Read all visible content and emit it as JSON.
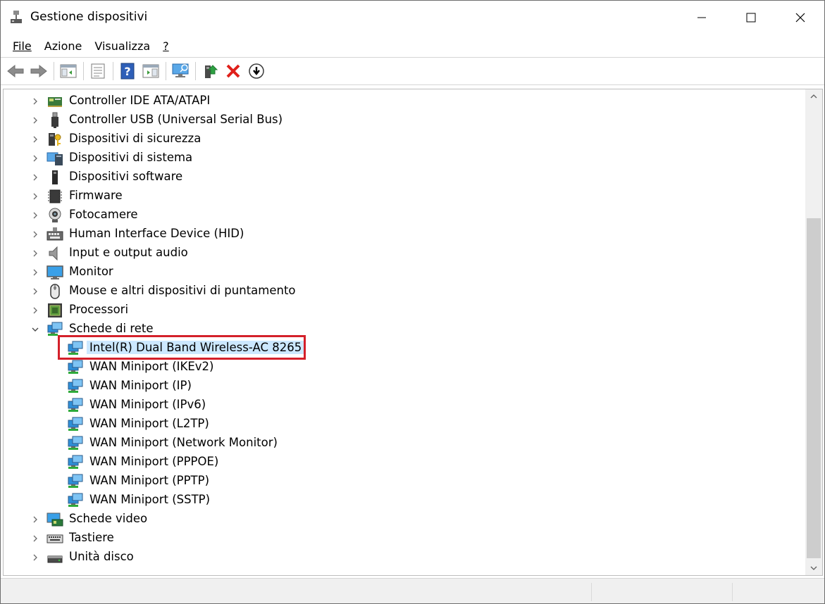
{
  "window": {
    "title": "Gestione dispositivi",
    "controls": {
      "minimize": "minimize-icon",
      "maximize": "maximize-icon",
      "close": "close-icon"
    }
  },
  "menu": [
    {
      "label": "File"
    },
    {
      "label": "Azione"
    },
    {
      "label": "Visualizza"
    },
    {
      "label": "?"
    }
  ],
  "toolbar": {
    "icons": [
      "back-arrow-icon",
      "forward-arrow-icon",
      "show-hide-console-tree-icon",
      "properties-icon",
      "help-icon",
      "action-pane-icon",
      "scan-hardware-icon",
      "update-driver-icon",
      "uninstall-device-icon",
      "disable-device-icon"
    ]
  },
  "tree": {
    "items": [
      {
        "label": "Controller IDE ATA/ATAPI",
        "icon": "ide-controller-icon",
        "expanded": false,
        "level": 0
      },
      {
        "label": "Controller USB (Universal Serial Bus)",
        "icon": "usb-icon",
        "expanded": false,
        "level": 0
      },
      {
        "label": "Dispositivi di sicurezza",
        "icon": "security-key-icon",
        "expanded": false,
        "level": 0
      },
      {
        "label": "Dispositivi di sistema",
        "icon": "system-device-icon",
        "expanded": false,
        "level": 0
      },
      {
        "label": "Dispositivi software",
        "icon": "software-device-icon",
        "expanded": false,
        "level": 0
      },
      {
        "label": "Firmware",
        "icon": "firmware-chip-icon",
        "expanded": false,
        "level": 0
      },
      {
        "label": "Fotocamere",
        "icon": "camera-icon",
        "expanded": false,
        "level": 0
      },
      {
        "label": "Human Interface Device (HID)",
        "icon": "hid-keyboard-icon",
        "expanded": false,
        "level": 0
      },
      {
        "label": "Input e output audio",
        "icon": "speaker-icon",
        "expanded": false,
        "level": 0
      },
      {
        "label": "Monitor",
        "icon": "monitor-icon",
        "expanded": false,
        "level": 0
      },
      {
        "label": "Mouse e altri dispositivi di puntamento",
        "icon": "mouse-icon",
        "expanded": false,
        "level": 0
      },
      {
        "label": "Processori",
        "icon": "processor-icon",
        "expanded": false,
        "level": 0
      },
      {
        "label": "Schede di rete",
        "icon": "network-adapter-icon",
        "expanded": true,
        "level": 0
      },
      {
        "label": "Intel(R) Dual Band Wireless-AC 8265",
        "icon": "network-adapter-icon",
        "level": 1,
        "selected": true
      },
      {
        "label": "WAN Miniport (IKEv2)",
        "icon": "network-adapter-icon",
        "level": 1
      },
      {
        "label": "WAN Miniport (IP)",
        "icon": "network-adapter-icon",
        "level": 1
      },
      {
        "label": "WAN Miniport (IPv6)",
        "icon": "network-adapter-icon",
        "level": 1
      },
      {
        "label": "WAN Miniport (L2TP)",
        "icon": "network-adapter-icon",
        "level": 1
      },
      {
        "label": "WAN Miniport (Network Monitor)",
        "icon": "network-adapter-icon",
        "level": 1
      },
      {
        "label": "WAN Miniport (PPPOE)",
        "icon": "network-adapter-icon",
        "level": 1
      },
      {
        "label": "WAN Miniport (PPTP)",
        "icon": "network-adapter-icon",
        "level": 1
      },
      {
        "label": "WAN Miniport (SSTP)",
        "icon": "network-adapter-icon",
        "level": 1
      },
      {
        "label": "Schede video",
        "icon": "video-card-icon",
        "expanded": false,
        "level": 0
      },
      {
        "label": "Tastiere",
        "icon": "keyboard-icon",
        "expanded": false,
        "level": 0
      },
      {
        "label": "Unità disco",
        "icon": "disk-drive-icon",
        "expanded": false,
        "level": 0
      }
    ]
  },
  "colors": {
    "selection": "#cce8ff",
    "highlight_border": "#d4202a",
    "network_icon": "#2f8fd8"
  }
}
